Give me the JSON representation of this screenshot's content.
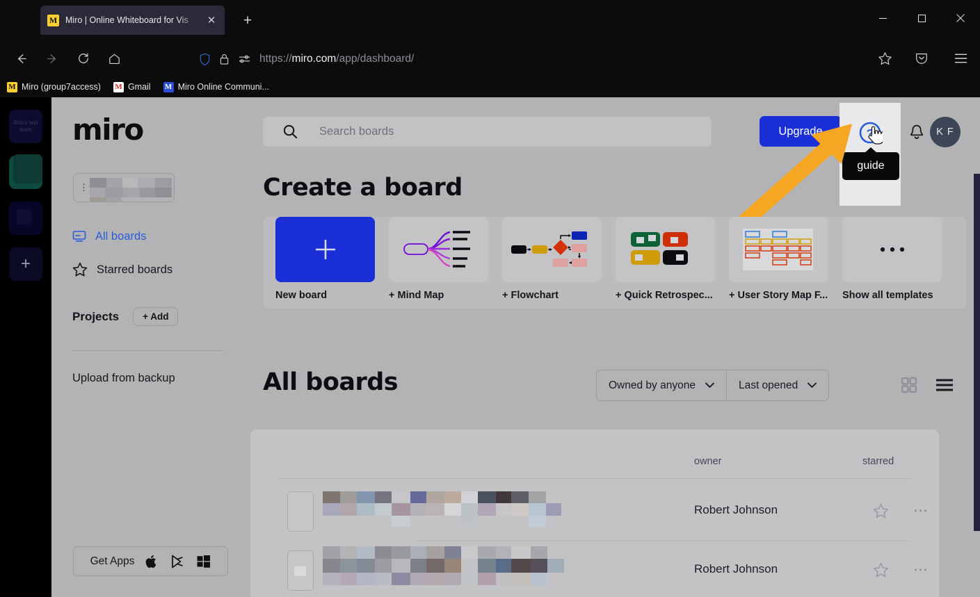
{
  "browser": {
    "tab": {
      "title": "Miro | Online Whiteboard for Vis",
      "favicon_letter": "M",
      "close_icon": "close-icon",
      "favicon_color": "#ffd02f"
    },
    "new_tab_label": "+",
    "window_controls": {
      "minimize": "—",
      "maximize": "□",
      "close": "✕"
    },
    "nav": {
      "back": "back-icon",
      "forward": "forward-icon",
      "reload": "reload-icon",
      "home": "home-icon"
    },
    "url": {
      "scheme": "https://",
      "host": "miro.com",
      "path": "/app/dashboard/"
    },
    "url_icons": [
      "shield-icon",
      "lock-icon",
      "permissions-icon"
    ],
    "toolbar_icons": [
      "bookmark-star-icon",
      "pocket-icon",
      "menu-icon"
    ],
    "bookmarks": [
      {
        "label": "Miro (group7access)",
        "icon": "miro-favicon",
        "color": "#ffd02f",
        "letter": "M"
      },
      {
        "label": "Gmail",
        "icon": "gmail-favicon",
        "color": "#ffffff",
        "letter": "M"
      },
      {
        "label": "Miro Online Communi...",
        "icon": "miro-community-favicon",
        "color": "#2a4fd6",
        "letter": "M"
      }
    ]
  },
  "rail": {
    "teams": [
      {
        "name": "Rob's test team",
        "color": "#0c0c2e",
        "has_text": true
      },
      {
        "name": "",
        "color": "#0e4a3f",
        "has_text": false
      },
      {
        "name": "",
        "color": "#060626",
        "has_text": false
      }
    ],
    "add_label": "+"
  },
  "sidebar": {
    "logo": "miro",
    "team_selector": {
      "value": "",
      "blurred": true
    },
    "items": [
      {
        "label": "All boards",
        "icon": "board-icon",
        "active": true
      },
      {
        "label": "Starred boards",
        "icon": "star-icon",
        "active": false
      }
    ],
    "projects": {
      "title": "Projects",
      "add_label": "+ Add"
    },
    "upload_label": "Upload from backup",
    "get_apps": {
      "label": "Get Apps",
      "icons": [
        "apple-icon",
        "google-play-icon",
        "windows-icon"
      ]
    }
  },
  "header": {
    "search": {
      "placeholder": "Search boards",
      "value": "",
      "icon": "search-icon"
    },
    "upgrade_label": "Upgrade",
    "guide": {
      "icon": "question-circle-icon",
      "tooltip": "guide",
      "highlighted": true,
      "cursor": "pointer-hand-cursor"
    },
    "notifications_icon": "bell-icon",
    "avatar_initials": "K F"
  },
  "annotation": {
    "arrow": {
      "color": "#f5a623",
      "points_to": "guide-button"
    }
  },
  "create_section": {
    "title": "Create a board",
    "templates": [
      {
        "label": "New board",
        "thumb": "plus-thumb"
      },
      {
        "label": "+ Mind Map",
        "thumb": "mindmap-thumb"
      },
      {
        "label": "+ Flowchart",
        "thumb": "flowchart-thumb"
      },
      {
        "label": "+ Quick Retrospec...",
        "thumb": "retrospective-thumb"
      },
      {
        "label": "+ User Story Map F...",
        "thumb": "userstorymap-thumb"
      },
      {
        "label": "Show all templates",
        "thumb": "ellipsis-thumb"
      }
    ]
  },
  "boards_section": {
    "title": "All boards",
    "filters": [
      {
        "label": "Owned by anyone",
        "icon": "chevron-down-icon"
      },
      {
        "label": "Last opened",
        "icon": "chevron-down-icon"
      }
    ],
    "view_toggles": [
      {
        "name": "grid-view",
        "active": false
      },
      {
        "name": "list-view",
        "active": true
      }
    ],
    "columns": [
      "",
      "owner",
      "starred"
    ],
    "rows": [
      {
        "title": "",
        "blurred": true,
        "owner": "Robert Johnson",
        "starred": false
      },
      {
        "title": "",
        "blurred": true,
        "owner": "Robert Johnson",
        "starred": false
      }
    ]
  },
  "colors": {
    "brand_blue": "#1a30d6",
    "link_blue": "#2b5bd7",
    "arrow_orange": "#f5a623",
    "tooltip_bg": "#0a0a0a",
    "page_bg": "#b3b3b6",
    "rail_bg": "#000000",
    "right_panel": "#23213d"
  }
}
